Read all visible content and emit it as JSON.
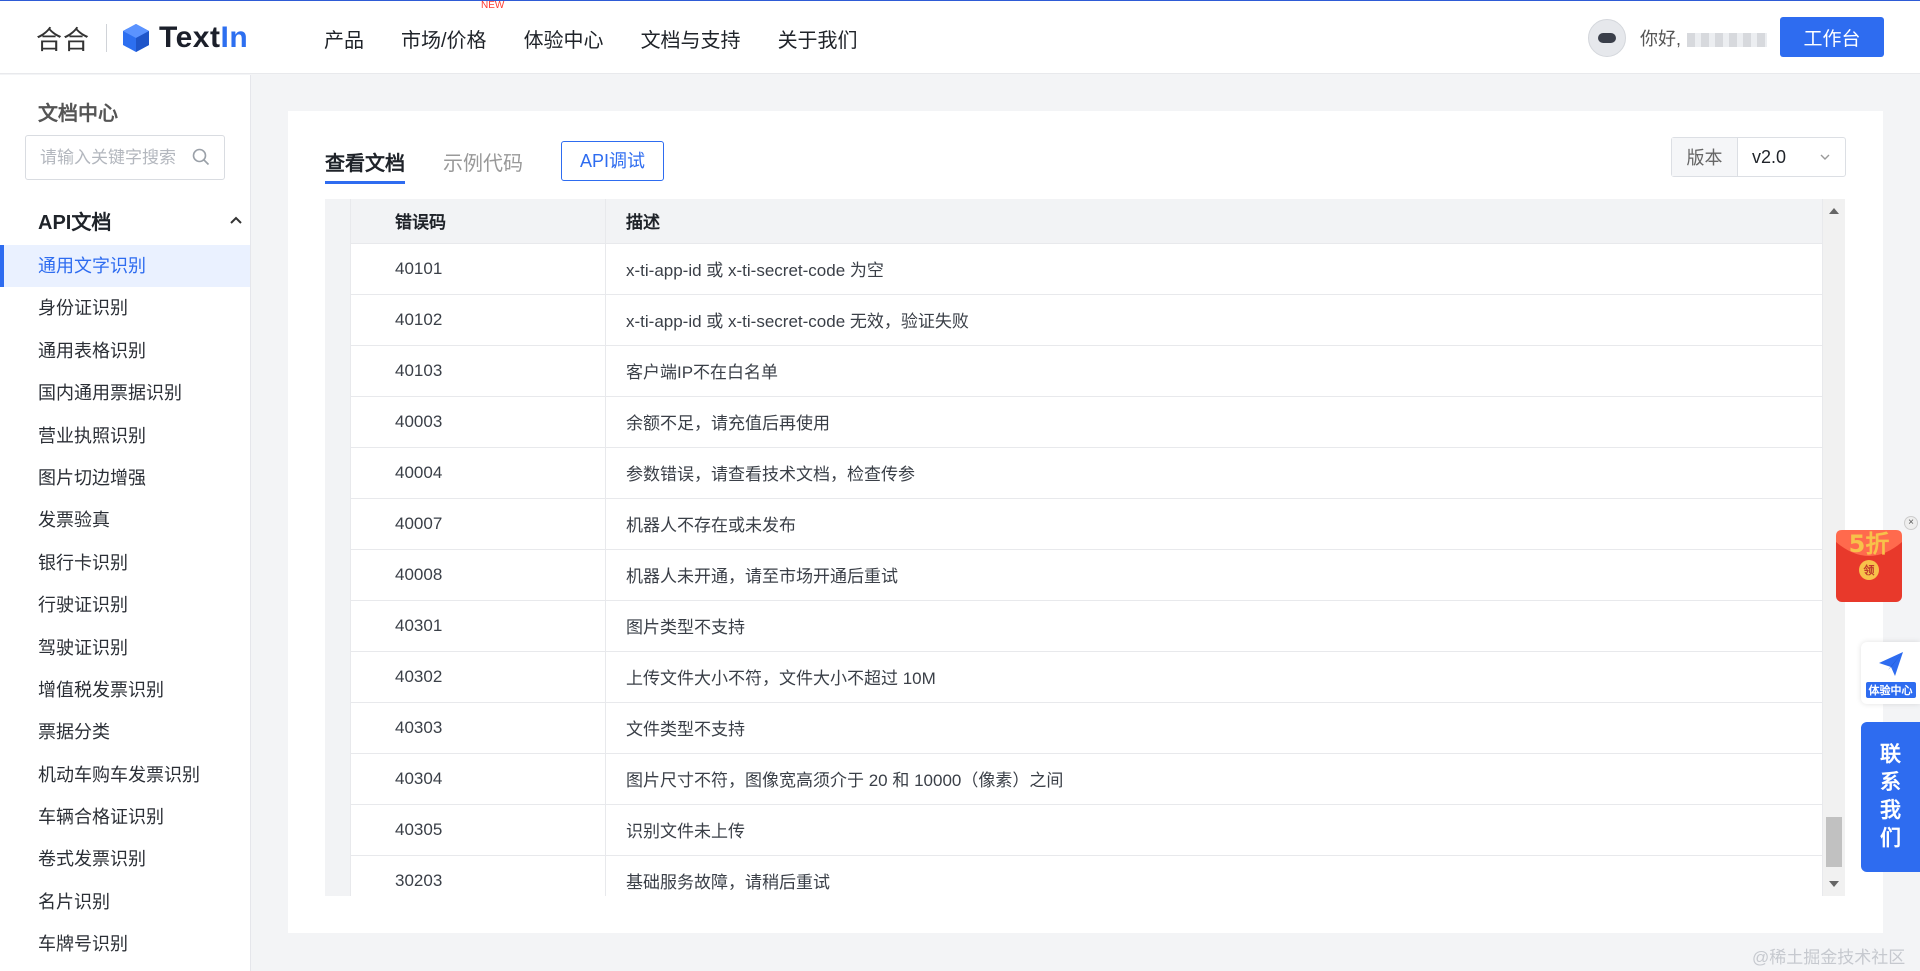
{
  "header": {
    "brand_he": "合合",
    "brand_name_a": "Text",
    "brand_name_b": "In",
    "nav": [
      {
        "label": "产品"
      },
      {
        "label": "市场/价格",
        "badge": "NEW"
      },
      {
        "label": "体验中心"
      },
      {
        "label": "文档与支持"
      },
      {
        "label": "关于我们"
      }
    ],
    "greeting": "你好,",
    "workbench_label": "工作台"
  },
  "sidebar": {
    "title": "文档中心",
    "search_placeholder": "请输入关键字搜索",
    "section_label": "API文档",
    "items": [
      {
        "label": "通用文字识别",
        "active": true
      },
      {
        "label": "身份证识别"
      },
      {
        "label": "通用表格识别"
      },
      {
        "label": "国内通用票据识别"
      },
      {
        "label": "营业执照识别"
      },
      {
        "label": "图片切边增强"
      },
      {
        "label": "发票验真"
      },
      {
        "label": "银行卡识别"
      },
      {
        "label": "行驶证识别"
      },
      {
        "label": "驾驶证识别"
      },
      {
        "label": "增值税发票识别"
      },
      {
        "label": "票据分类"
      },
      {
        "label": "机动车购车发票识别"
      },
      {
        "label": "车辆合格证识别"
      },
      {
        "label": "卷式发票识别"
      },
      {
        "label": "名片识别"
      },
      {
        "label": "车牌号识别"
      }
    ]
  },
  "main": {
    "tabs": [
      {
        "label": "查看文档",
        "active": true
      },
      {
        "label": "示例代码"
      }
    ],
    "api_debug_label": "API调试",
    "version_label": "版本",
    "version_value": "v2.0",
    "table": {
      "headers": [
        "错误码",
        "描述"
      ],
      "rows": [
        [
          "40101",
          "x-ti-app-id 或 x-ti-secret-code 为空"
        ],
        [
          "40102",
          "x-ti-app-id 或 x-ti-secret-code 无效，验证失败"
        ],
        [
          "40103",
          "客户端IP不在白名单"
        ],
        [
          "40003",
          "余额不足，请充值后再使用"
        ],
        [
          "40004",
          "参数错误，请查看技术文档，检查传参"
        ],
        [
          "40007",
          "机器人不存在或未发布"
        ],
        [
          "40008",
          "机器人未开通，请至市场开通后重试"
        ],
        [
          "40301",
          "图片类型不支持"
        ],
        [
          "40302",
          "上传文件大小不符，文件大小不超过 10M"
        ],
        [
          "40303",
          "文件类型不支持"
        ],
        [
          "40304",
          "图片尺寸不符，图像宽高须介于 20 和 10000（像素）之间"
        ],
        [
          "40305",
          "识别文件未上传"
        ],
        [
          "30203",
          "基础服务故障，请稍后重试"
        ]
      ]
    }
  },
  "floating": {
    "promo_text": "5折",
    "promo_sub": "领",
    "experience_label": "体验中心",
    "contact_chars": [
      "联",
      "系",
      "我",
      "们"
    ],
    "close_glyph": "×"
  },
  "watermark": "@稀土掘金技术社区",
  "colors": {
    "accent": "#2e6cf0",
    "promo": "#e8392b"
  }
}
